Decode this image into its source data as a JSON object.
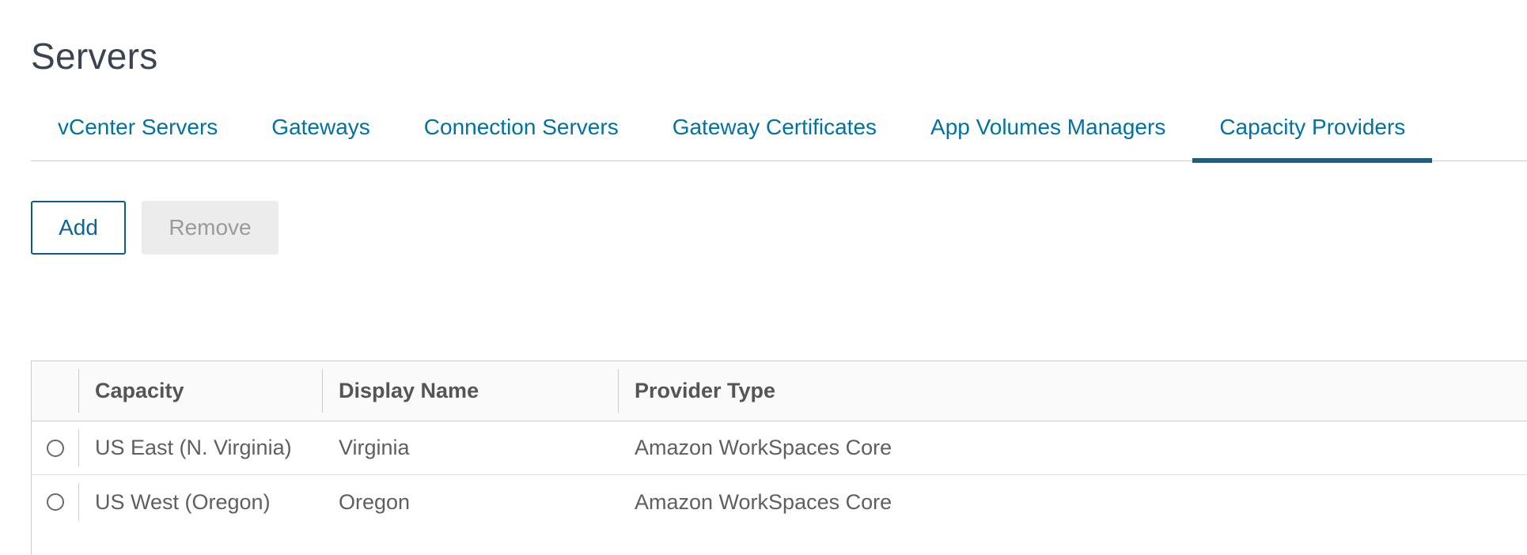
{
  "page": {
    "title": "Servers"
  },
  "tabs": [
    {
      "label": "vCenter Servers",
      "active": false
    },
    {
      "label": "Gateways",
      "active": false
    },
    {
      "label": "Connection Servers",
      "active": false
    },
    {
      "label": "Gateway Certificates",
      "active": false
    },
    {
      "label": "App Volumes Managers",
      "active": false
    },
    {
      "label": "Capacity Providers",
      "active": true
    }
  ],
  "toolbar": {
    "add_label": "Add",
    "remove_label": "Remove"
  },
  "grid": {
    "columns": [
      "Capacity",
      "Display Name",
      "Provider Type"
    ],
    "rows": [
      {
        "capacity": "US East (N. Virginia)",
        "display_name": "Virginia",
        "provider_type": "Amazon WorkSpaces Core"
      },
      {
        "capacity": "US West (Oregon)",
        "display_name": "Oregon",
        "provider_type": "Amazon WorkSpaces Core"
      }
    ]
  },
  "colors": {
    "link": "#0072a3",
    "active_tab_underline": "#1f5e82",
    "title": "#3b4452"
  }
}
